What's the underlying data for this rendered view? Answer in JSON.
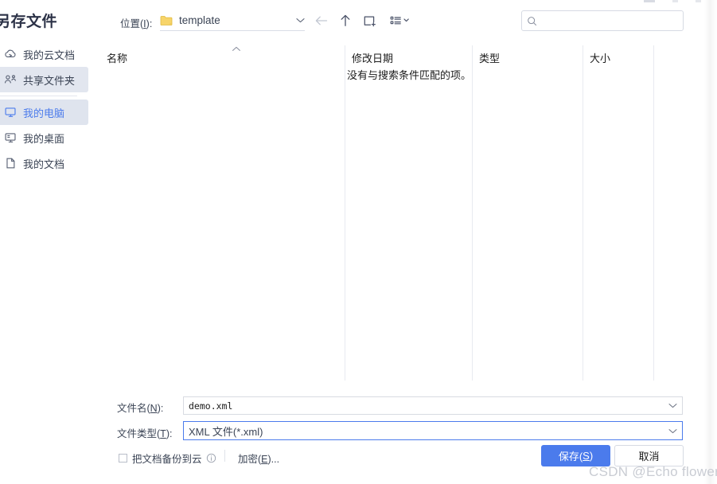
{
  "dialog": {
    "title": "另存文件"
  },
  "sidebar": {
    "items": [
      {
        "label": "我的云文档",
        "icon": "cloud-doc-icon",
        "state": "normal"
      },
      {
        "label": "共享文件夹",
        "icon": "shared-folder-icon",
        "state": "hover"
      },
      {
        "label": "我的电脑",
        "icon": "computer-icon",
        "state": "selected"
      },
      {
        "label": "我的桌面",
        "icon": "desktop-icon",
        "state": "normal"
      },
      {
        "label": "我的文档",
        "icon": "documents-icon",
        "state": "normal"
      }
    ]
  },
  "toolbar": {
    "location_label": "位置(I):",
    "location_label_mnemonic": "I",
    "current_path": "template",
    "path_icon": "folder-icon",
    "buttons": [
      {
        "name": "back-button",
        "icon": "arrow-left-icon",
        "enabled": false
      },
      {
        "name": "up-button",
        "icon": "arrow-up-icon",
        "enabled": true
      },
      {
        "name": "new-folder-button",
        "icon": "new-folder-icon",
        "enabled": true
      },
      {
        "name": "view-options-button",
        "icon": "list-view-icon",
        "enabled": true
      }
    ]
  },
  "search": {
    "icon": "search-icon",
    "value": "",
    "placeholder": ""
  },
  "file_list": {
    "columns": [
      {
        "label": "名称",
        "sort": "ascending"
      },
      {
        "label": "修改日期",
        "sort": "none"
      },
      {
        "label": "类型",
        "sort": "none"
      },
      {
        "label": "大小",
        "sort": "none"
      }
    ],
    "empty_message": "没有与搜索条件匹配的项。",
    "rows": []
  },
  "form": {
    "filename_label": "文件名(N):",
    "filename_mnemonic": "N",
    "filename_value": "demo.xml",
    "filetype_label": "文件类型(T):",
    "filetype_mnemonic": "T",
    "filetype_value": "XML 文件(*.xml)"
  },
  "footer": {
    "backup_checkbox_label": "把文档备份到云",
    "backup_checked": false,
    "info_icon": "info-icon",
    "encrypt_link": "加密(E)...",
    "encrypt_mnemonic": "E",
    "save_label": "保存(S)",
    "save_mnemonic": "S",
    "cancel_label": "取消",
    "watermark": "CSDN @Echo flower"
  },
  "colors": {
    "accent": "#4b7bec",
    "selected_bg": "#dfe4ee",
    "hover_bg": "#e2e6ef",
    "text": "#3b4455",
    "folder_yellow": "#f5cf60",
    "border": "#d6dae3",
    "watermark": "#c9ccd3"
  }
}
